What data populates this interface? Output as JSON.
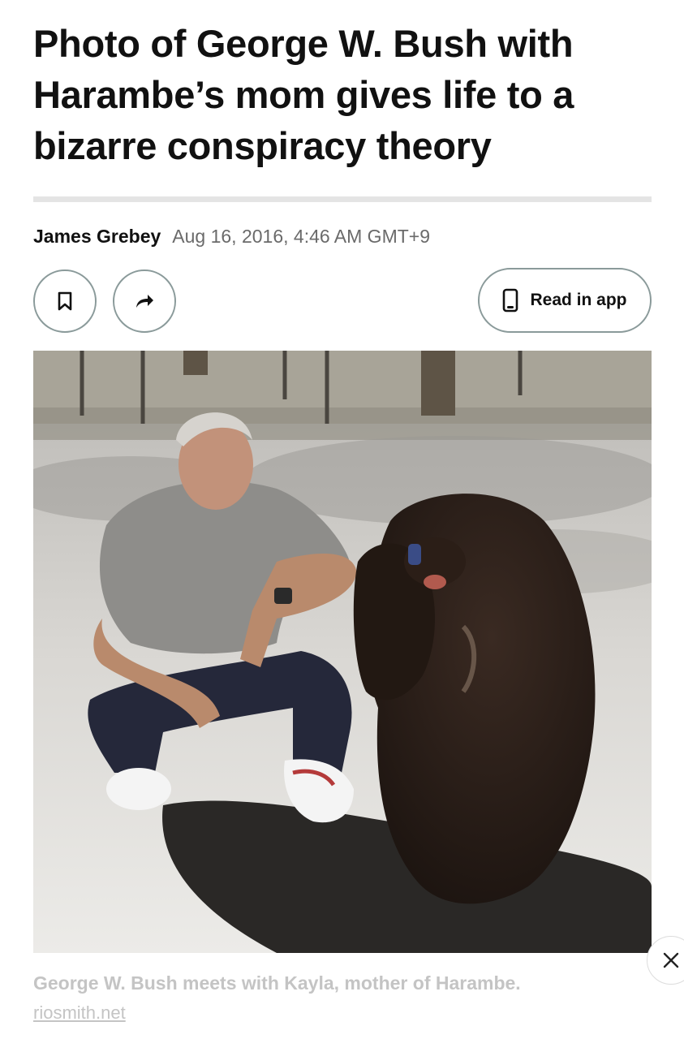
{
  "article": {
    "headline": "Photo of George W. Bush with Harambe’s mom gives life to a bizarre conspiracy theory",
    "author": "James Grebey",
    "date": "Aug 16, 2016, 4:46 AM GMT+9"
  },
  "actions": {
    "bookmark_icon": "bookmark-icon",
    "share_icon": "share-arrow-icon",
    "read_in_app_label": "Read in app",
    "phone_icon": "phone-icon"
  },
  "photo": {
    "caption": "George W. Bush meets with Kayla, mother of Harambe.",
    "source": "riosmith.net"
  },
  "overlay": {
    "close_icon": "close-icon"
  }
}
